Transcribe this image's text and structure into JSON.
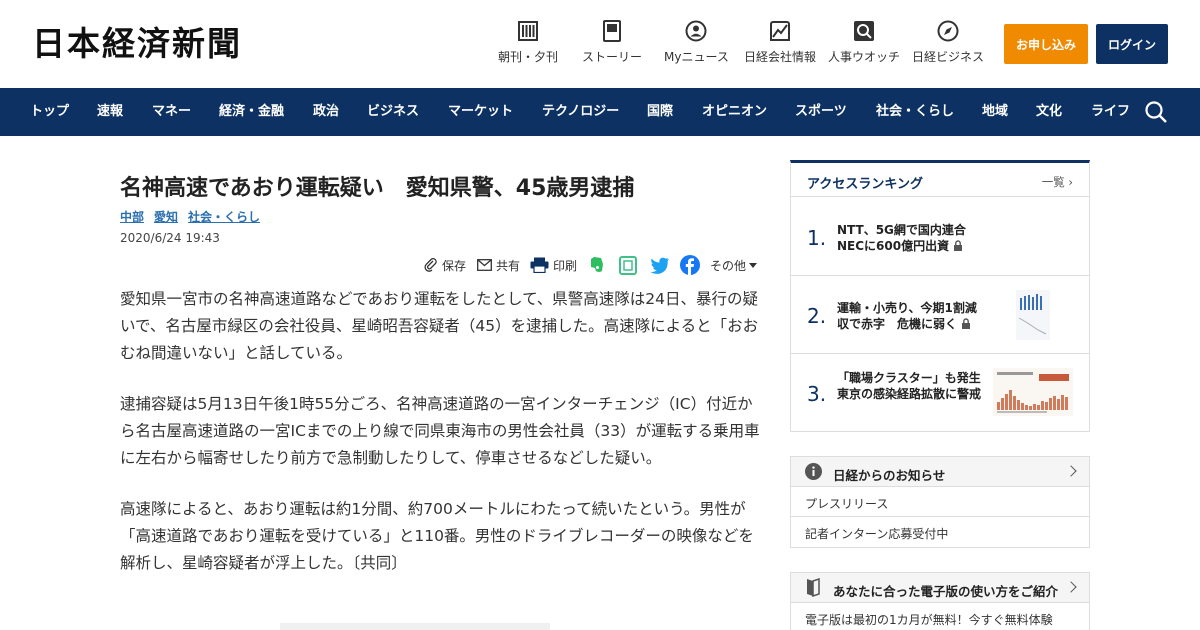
{
  "header": {
    "logo": "日本経済新聞",
    "nav": [
      {
        "label": "朝刊・夕刊",
        "icon": "newspaper-icon"
      },
      {
        "label": "ストーリー",
        "icon": "document-icon"
      },
      {
        "label": "Myニュース",
        "icon": "person-icon"
      },
      {
        "label": "日経会社情報",
        "icon": "company-chart-icon"
      },
      {
        "label": "人事ウオッチ",
        "icon": "magnifier-icon"
      },
      {
        "label": "日経ビジネス",
        "icon": "compass-icon"
      }
    ],
    "apply_label": "お申し込み",
    "login_label": "ログイン"
  },
  "navbar": {
    "items": [
      "トップ",
      "速報",
      "マネー",
      "経済・金融",
      "政治",
      "ビジネス",
      "マーケット",
      "テクノロジー",
      "国際",
      "オピニオン",
      "スポーツ",
      "社会・くらし",
      "地域",
      "文化",
      "ライフ"
    ],
    "search_icon": "search-icon"
  },
  "article": {
    "title": "名神高速であおり運転疑い　愛知県警、45歳男逮捕",
    "tags": [
      "中部",
      "愛知",
      "社会・くらし"
    ],
    "date": "2020/6/24 19:43",
    "share": {
      "save": "保存",
      "share": "共有",
      "print": "印刷",
      "more": "その他"
    },
    "paragraphs": [
      "愛知県一宮市の名神高速道路などであおり運転をしたとして、県警高速隊は24日、暴行の疑いで、名古屋市緑区の会社役員、星崎昭吾容疑者（45）を逮捕した。高速隊によると「おおむね間違いない」と話している。",
      "逮捕容疑は5月13日午後1時55分ごろ、名神高速道路の一宮インターチェンジ（IC）付近から名古屋高速道路の一宮ICまでの上り線で同県東海市の男性会社員（33）が運転する乗用車に左右から幅寄せしたり前方で急制動したりして、停車させるなどした疑い。",
      "高速隊によると、あおり運転は約1分間、約700メートルにわたって続いたという。男性が「高速道路であおり運転を受けている」と110番。男性のドライブレコーダーの映像などを解析し、星崎容疑者が浮上した。〔共同〕"
    ]
  },
  "ranking": {
    "title": "アクセスランキング",
    "all_label": "一覧",
    "items": [
      {
        "rank": "1.",
        "text": "NTT、5G網で国内連合　NECに600億円出資"
      },
      {
        "rank": "2.",
        "text": "運輸・小売り、今期1割減収で赤字　危機に弱く"
      },
      {
        "rank": "3.",
        "text": "「職場クラスター」も発生　東京の感染経路拡散に警戒"
      }
    ]
  },
  "info": {
    "title": "日経からのお知らせ",
    "links": [
      "プレスリリース",
      "記者インターン応募受付中"
    ]
  },
  "guide": {
    "title": "あなたに合った電子版の使い方をご紹介",
    "text": "電子版は最初の1カ月が無料！今すぐ無料体験"
  },
  "colors": {
    "brand_navy": "#0c3162",
    "apply_orange": "#f08a00",
    "link_blue": "#2a6fb0"
  }
}
